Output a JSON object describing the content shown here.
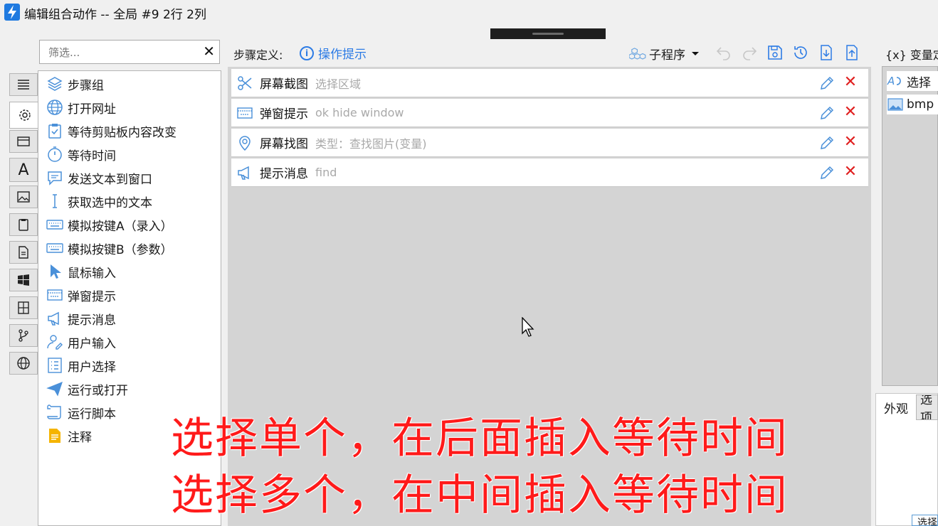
{
  "window": {
    "title": "编辑组合动作 -- 全局 #9 2行 2列"
  },
  "filter": {
    "placeholder": "筛选...",
    "clear_label": "✕"
  },
  "action_list": [
    {
      "label": "步骤组",
      "icon": "layers-icon"
    },
    {
      "label": "打开网址",
      "icon": "globe-icon"
    },
    {
      "label": "等待剪贴板内容改变",
      "icon": "clipboard-check-icon"
    },
    {
      "label": "等待时间",
      "icon": "timer-icon"
    },
    {
      "label": "发送文本到窗口",
      "icon": "chat-icon"
    },
    {
      "label": "获取选中的文本",
      "icon": "text-cursor-icon"
    },
    {
      "label": "模拟按键A（录入）",
      "icon": "keyboard-icon"
    },
    {
      "label": "模拟按键B（参数）",
      "icon": "keyboard-icon"
    },
    {
      "label": "鼠标输入",
      "icon": "mouse-pointer-icon"
    },
    {
      "label": "弹窗提示",
      "icon": "window-icon"
    },
    {
      "label": "提示消息",
      "icon": "megaphone-icon"
    },
    {
      "label": "用户输入",
      "icon": "user-edit-icon"
    },
    {
      "label": "用户选择",
      "icon": "checklist-icon"
    },
    {
      "label": "运行或打开",
      "icon": "paper-plane-icon"
    },
    {
      "label": "运行脚本",
      "icon": "scroll-icon"
    },
    {
      "label": "注释",
      "icon": "note-icon"
    }
  ],
  "steps_header": {
    "label": "步骤定义:",
    "hint_label": "操作提示",
    "subprogram_label": "子程序"
  },
  "steps": [
    {
      "name": "屏幕截图",
      "detail": "选择区域",
      "icon": "scissors-icon"
    },
    {
      "name": "弹窗提示",
      "detail": "ok hide window",
      "icon": "window-icon"
    },
    {
      "name": "屏幕找图",
      "detail": "类型：查找图片(变量)",
      "icon": "location-search-icon"
    },
    {
      "name": "提示消息",
      "detail": "find",
      "icon": "megaphone-icon"
    }
  ],
  "variables": {
    "label": "{x} 变量定",
    "items": [
      {
        "name": "选择",
        "icon": "text-var-icon"
      },
      {
        "name": "bmp",
        "icon": "image-var-icon"
      }
    ]
  },
  "properties": {
    "tabs": [
      "外观",
      "选项"
    ],
    "select_button": "选择"
  },
  "captions": [
    "选择单个，在后面插入等待时间",
    "选择多个，在中间插入等待时间"
  ],
  "colors": {
    "accent": "#2c7be5",
    "delete": "#e02020",
    "caption": "#ff1a1a"
  }
}
